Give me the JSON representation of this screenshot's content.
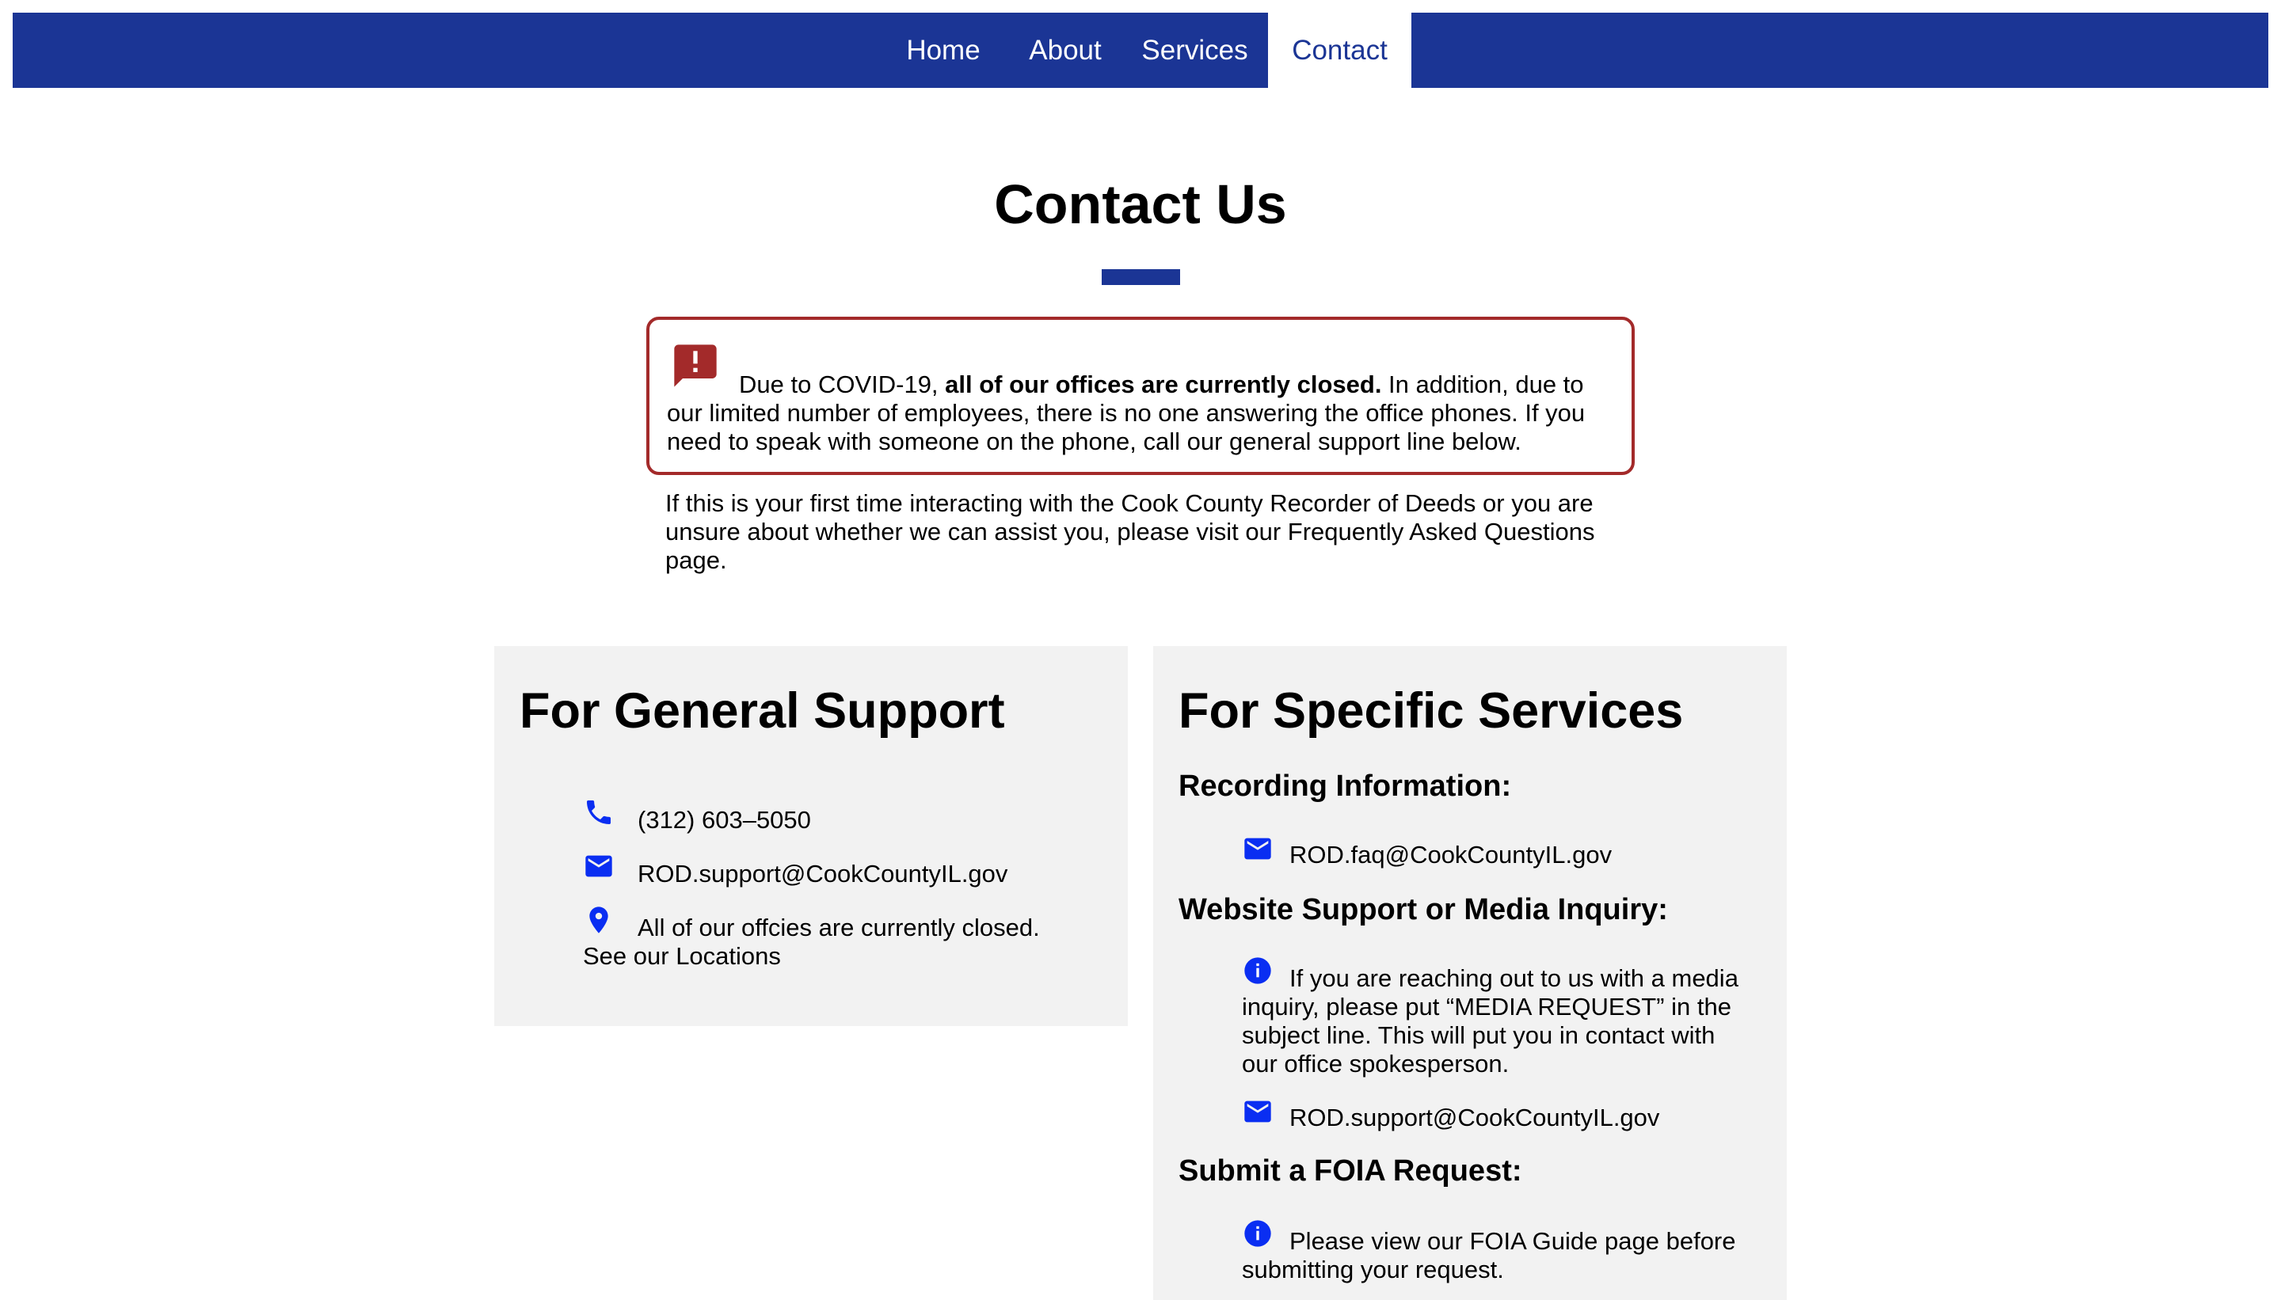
{
  "colors": {
    "brand_blue": "#1b3595",
    "alert_red": "#a32a2a",
    "icon_blue": "#0a2ef2",
    "card_bg": "#f2f2f2"
  },
  "nav": {
    "items": [
      {
        "label": "Home",
        "active": false
      },
      {
        "label": "About",
        "active": false
      },
      {
        "label": "Services",
        "active": false
      },
      {
        "label": "Contact",
        "active": true
      }
    ]
  },
  "page": {
    "title": "Contact Us"
  },
  "alert": {
    "icon": "alert-feedback-icon",
    "text_lead": "Due to COVID-19, ",
    "text_bold": "all of our offices are currently closed.",
    "text_rest": " In addition, due to our limited number of employees, there is no one answering the office phones. If you need to speak with someone on the phone, call our general support line below."
  },
  "intro": {
    "text": "If this is your first time interacting with the Cook County Recorder of Deeds or you are unsure about whether we can assist you, please visit our Frequently Asked Questions page."
  },
  "general_support": {
    "title": "For General Support",
    "phone": {
      "icon": "phone-icon",
      "text": "(312) 603–5050"
    },
    "email": {
      "icon": "mail-icon",
      "text": "ROD.support@CookCountyIL.gov"
    },
    "location": {
      "icon": "location-pin-icon",
      "text": "All of our offcies are currently closed.",
      "link": "See our Locations"
    }
  },
  "specific_services": {
    "title": "For Specific Services",
    "recording": {
      "heading": "Recording Information:",
      "email": {
        "icon": "mail-icon",
        "text": "ROD.faq@CookCountyIL.gov"
      }
    },
    "website_media": {
      "heading": "Website Support or Media Inquiry:",
      "info": {
        "icon": "info-icon",
        "text": "If you are reaching out to us with a media inquiry, please put “MEDIA REQUEST” in the subject line. This will put you in contact with our office spokesperson."
      },
      "email": {
        "icon": "mail-icon",
        "text": "ROD.support@CookCountyIL.gov"
      }
    },
    "foia": {
      "heading": "Submit a FOIA Request:",
      "info": {
        "icon": "info-icon",
        "text": "Please view our FOIA Guide page before submitting your request."
      }
    }
  }
}
